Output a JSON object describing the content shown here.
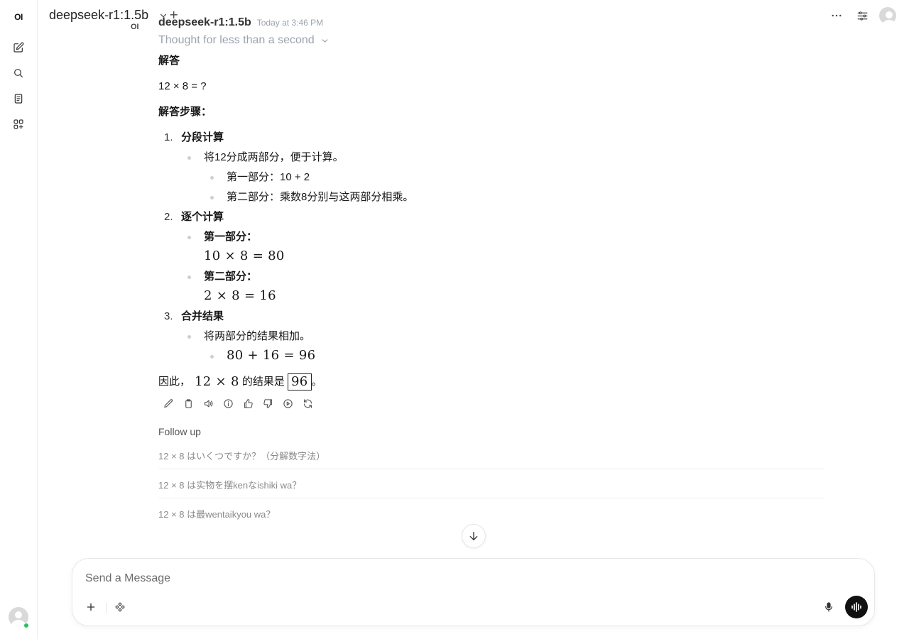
{
  "sidebar": {
    "logo": "OI",
    "items": [
      {
        "name": "new-chat",
        "icon": "pencil-square-icon"
      },
      {
        "name": "search",
        "icon": "search-icon"
      },
      {
        "name": "notes",
        "icon": "notes-icon"
      },
      {
        "name": "workspace",
        "icon": "grid-plus-icon"
      }
    ],
    "status_color": "#22c55e"
  },
  "header": {
    "model_name": "deepseek-r1:1.5b",
    "new_model_symbol": "+"
  },
  "message": {
    "logo": "OI",
    "model": "deepseek-r1:1.5b",
    "time": "Today at 3:46 PM",
    "thought": "Thought for less than a second",
    "heading": "解答",
    "question": "12 × 8 = ?",
    "steps_title": "解答步骤：",
    "steps": [
      {
        "num": "1.",
        "title": "分段计算",
        "bullet": "将12分成两部分，便于计算。",
        "sub": [
          "第一部分：10 + 2",
          "第二部分：乘数8分别与这两部分相乘。"
        ]
      },
      {
        "num": "2.",
        "title": "逐个计算",
        "part1_label": "第一部分：",
        "part1_math": "10 × 8 = 80",
        "part2_label": "第二部分：",
        "part2_math": "2 × 8 = 16"
      },
      {
        "num": "3.",
        "title": "合并结果",
        "bullet": "将两部分的结果相加。",
        "sub_math": "80 + 16 = 96"
      }
    ],
    "conclusion_prefix": "因此，",
    "conclusion_math": "12 × 8",
    "conclusion_mid": " 的结果是 ",
    "conclusion_answer": "96",
    "conclusion_suffix": "。"
  },
  "actions": [
    "edit-icon",
    "copy-icon",
    "speaker-icon",
    "info-icon",
    "thumbs-up-icon",
    "thumbs-down-icon",
    "play-icon",
    "regenerate-icon"
  ],
  "follow_up": {
    "title": "Follow up",
    "items": [
      "12 × 8 はいくつですか？（分解数字法）",
      "12 × 8 は实物を摆kenなishiki wa？",
      "12 × 8 は最wentaikyou wa？"
    ]
  },
  "input": {
    "placeholder": "Send a Message"
  },
  "colors": {
    "accent": "#111111",
    "muted": "#9ca3af"
  }
}
